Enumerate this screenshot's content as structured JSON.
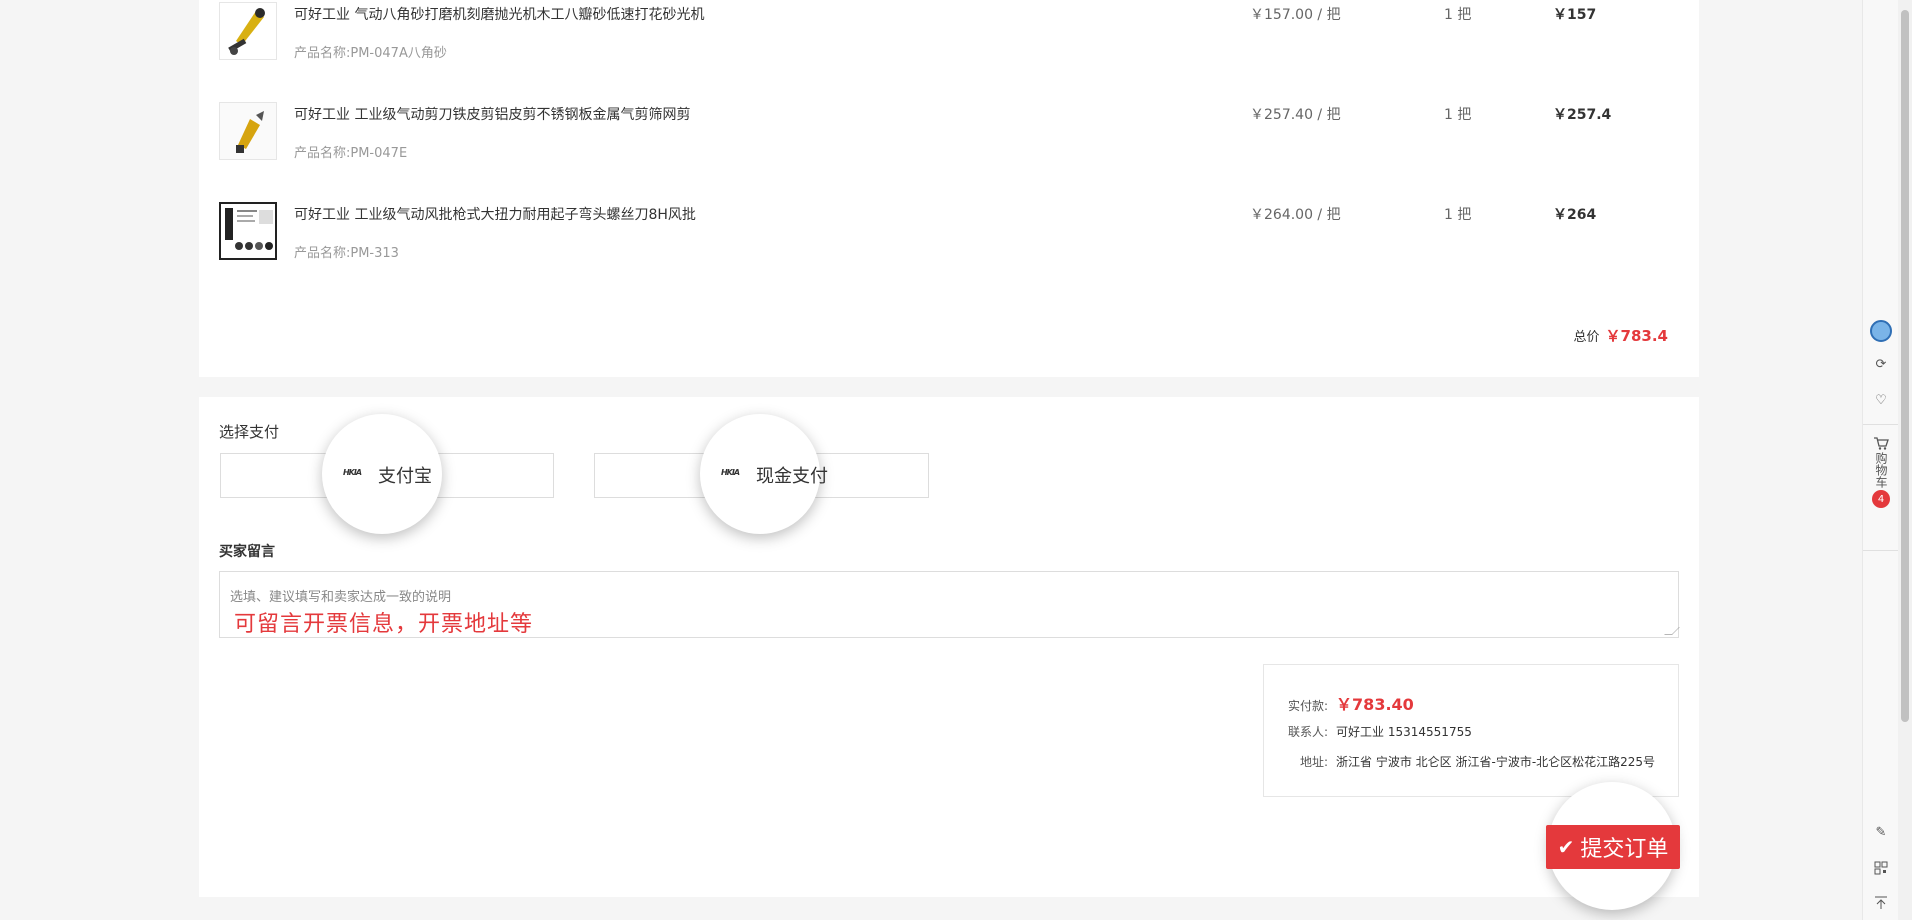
{
  "products": [
    {
      "title": "可好工业 气动八角砂打磨机刻磨抛光机木工八瓣砂低速打花砂光机",
      "sub": "产品名称:PM-047A八角砂",
      "price": "￥157.00 / 把",
      "qty": "1 把",
      "subtotal": "￥157"
    },
    {
      "title": "可好工业 工业级气动剪刀铁皮剪铝皮剪不锈钢板金属气剪筛网剪",
      "sub": "产品名称:PM-047E",
      "price": "￥257.40 / 把",
      "qty": "1 把",
      "subtotal": "￥257.4"
    },
    {
      "title": "可好工业 工业级气动风批枪式大扭力耐用起子弯头螺丝刀8H风批",
      "sub": "产品名称:PM-313",
      "price": "￥264.00 / 把",
      "qty": "1 把",
      "subtotal": "￥264"
    }
  ],
  "total": {
    "label": "总价",
    "amount": "￥783.4"
  },
  "payment": {
    "title": "选择支付",
    "alipay": {
      "logo": "HKIA",
      "label": "支付宝"
    },
    "cash": {
      "logo": "HKIA",
      "label": "现金支付"
    }
  },
  "message": {
    "title": "买家留言",
    "placeholder": "选填、建议填写和卖家达成一致的说明",
    "note": "可留言开票信息，开票地址等"
  },
  "summary": {
    "pay_label": "实付款:",
    "pay_value": "￥783.40",
    "contact_label": "联系人:",
    "contact_value": "可好工业 15314551755",
    "address_label": "地址:",
    "address_value": "浙江省 宁波市 北仑区 浙江省-宁波市-北仑区松花江路225号"
  },
  "submit": {
    "label": "提交订单",
    "icon": "check-icon"
  },
  "toolbar": {
    "cart_label": "购物车",
    "cart_count": "4"
  },
  "colors": {
    "accent": "#e4393c",
    "background": "#f5f5f5"
  }
}
